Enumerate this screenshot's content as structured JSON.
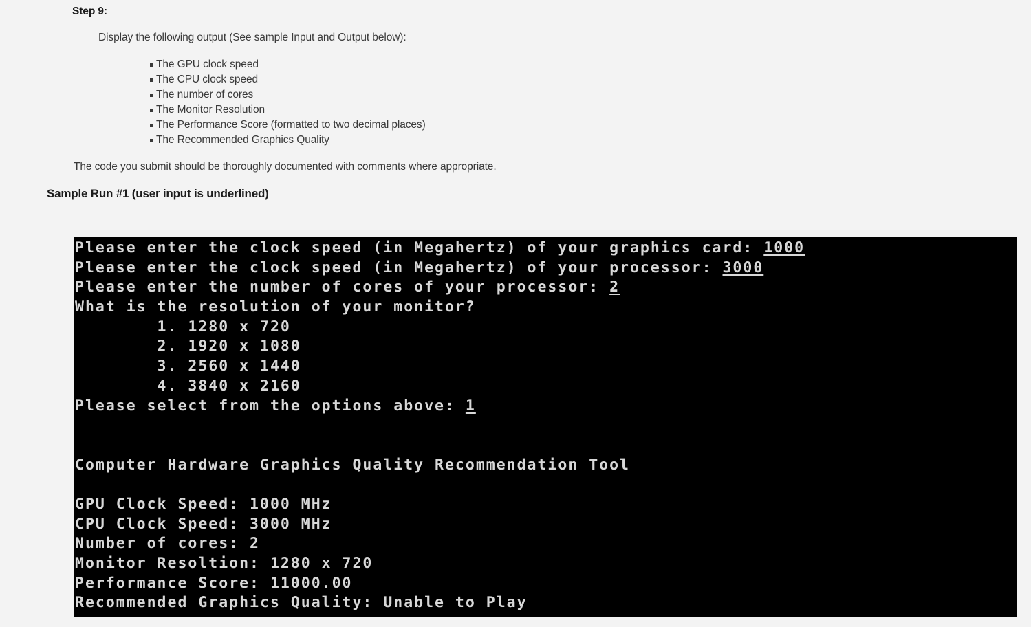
{
  "document": {
    "step_heading": "Step 9:",
    "intro_line": "Display the following output (See sample Input and Output below):",
    "bullets": [
      "The GPU clock speed",
      "The CPU clock speed",
      "The number of cores",
      "The Monitor Resolution",
      "The Performance Score (formatted to two decimal places)",
      "The Recommended Graphics Quality"
    ],
    "note_line": "The code you submit should be thoroughly documented with comments where appropriate.",
    "sample_heading": "Sample Run #1 (user input is underlined)"
  },
  "console": {
    "background_color": "#000000",
    "text_color": "#d8d8d8",
    "lines": [
      {
        "text": "Please enter the clock speed (in Megahertz) of your graphics card: ",
        "input": "1000"
      },
      {
        "text": "Please enter the clock speed (in Megahertz) of your processor: ",
        "input": "3000"
      },
      {
        "text": "Please enter the number of cores of your processor: ",
        "input": "2"
      },
      {
        "text": "What is the resolution of your monitor?",
        "input": ""
      },
      {
        "text": "        1. 1280 x 720",
        "input": ""
      },
      {
        "text": "        2. 1920 x 1080",
        "input": ""
      },
      {
        "text": "        3. 2560 x 1440",
        "input": ""
      },
      {
        "text": "        4. 3840 x 2160",
        "input": ""
      },
      {
        "text": "Please select from the options above: ",
        "input": "1"
      },
      {
        "text": "",
        "input": ""
      },
      {
        "text": "",
        "input": ""
      },
      {
        "text": "Computer Hardware Graphics Quality Recommendation Tool",
        "input": ""
      },
      {
        "text": "",
        "input": ""
      },
      {
        "text": "GPU Clock Speed: 1000 MHz",
        "input": ""
      },
      {
        "text": "CPU Clock Speed: 3000 MHz",
        "input": ""
      },
      {
        "text": "Number of cores: 2",
        "input": ""
      },
      {
        "text": "Monitor Resoltion: 1280 x 720",
        "input": ""
      },
      {
        "text": "Performance Score: 11000.00",
        "input": ""
      },
      {
        "text": "Recommended Graphics Quality: Unable to Play",
        "input": ""
      }
    ]
  },
  "colors": {
    "page_background": "#f3f3f3",
    "body_text": "#3a3a3a",
    "heading_text": "#1c1c1c"
  }
}
